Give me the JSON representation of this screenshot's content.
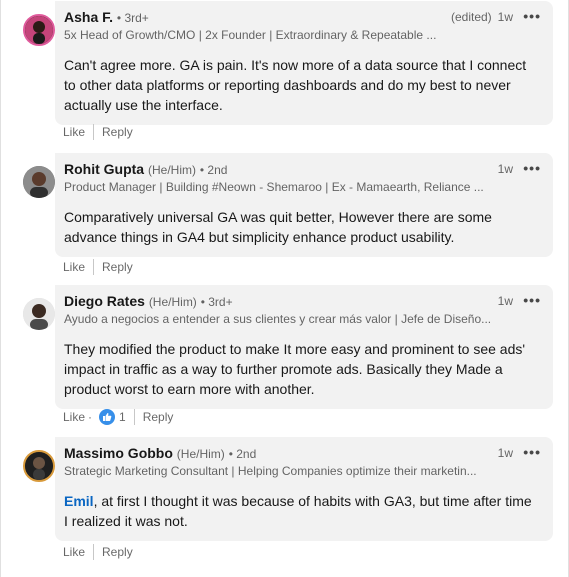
{
  "comments": [
    {
      "name": "Asha F.",
      "pronouns": "",
      "degree": "• 3rd+",
      "edited": "(edited)",
      "time": "1w",
      "headline": "5x Head of Growth/CMO | 2x Founder | Extraordinary & Repeatable ...",
      "text": "Can't agree more. GA is pain. It's now more of a data source that I connect to other data platforms or reporting dashboards and do my best to never actually use the interface.",
      "like": "Like",
      "reply": "Reply",
      "reactions": ""
    },
    {
      "name": "Rohit Gupta",
      "pronouns": "(He/Him)",
      "degree": "• 2nd",
      "edited": "",
      "time": "1w",
      "headline": "Product Manager | Building #Neown - Shemaroo | Ex - Mamaearth, Reliance ...",
      "text": "Comparatively universal GA was quit better, However there are some advance things in GA4 but simplicity enhance product usability.",
      "like": "Like",
      "reply": "Reply",
      "reactions": ""
    },
    {
      "name": "Diego Rates",
      "pronouns": "(He/Him)",
      "degree": "• 3rd+",
      "edited": "",
      "time": "1w",
      "headline": "Ayudo a negocios a entender a sus clientes y crear más valor | Jefe de Diseño...",
      "text": "They modified the product to make It more easy and prominent to see ads' impact in traffic as a way to further promote ads. Basically they Made a product worst to earn more with another.",
      "like": "Like",
      "reply": "Reply",
      "reactions": "1"
    },
    {
      "name": "Massimo Gobbo",
      "pronouns": "(He/Him)",
      "degree": "• 2nd",
      "edited": "",
      "time": "1w",
      "headline": "Strategic Marketing Consultant | Helping Companies optimize their marketin...",
      "mention": "Emil",
      "text": ", at first I thought it was because of habits with GA3, but time after time I realized it was not.",
      "like": "Like",
      "reply": "Reply",
      "reactions": ""
    }
  ],
  "more_menu": "•••",
  "colors": {
    "link": "#0a66c2",
    "bubble": "#f2f2f2",
    "like_icon": "#378fe9"
  }
}
